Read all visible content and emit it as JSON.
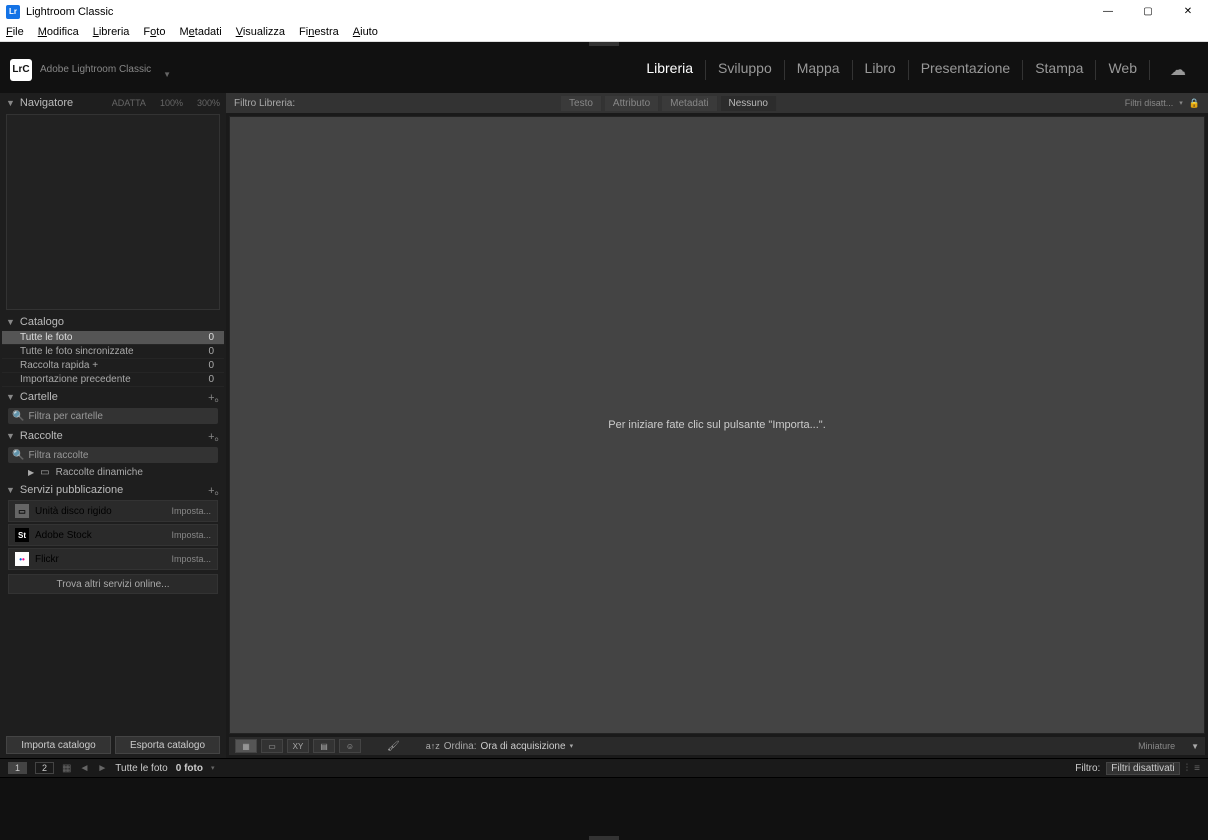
{
  "app": {
    "title": "Lightroom Classic",
    "brand": "Adobe Lightroom Classic",
    "badge": "LrC"
  },
  "menu": [
    "File",
    "Modifica",
    "Libreria",
    "Foto",
    "Metadati",
    "Visualizza",
    "Finestra",
    "Aiuto"
  ],
  "menuAccel": [
    "F",
    "M",
    "L",
    "o",
    "e",
    "V",
    "n",
    "A"
  ],
  "modules": {
    "items": [
      "Libreria",
      "Sviluppo",
      "Mappa",
      "Libro",
      "Presentazione",
      "Stampa",
      "Web"
    ],
    "active": 0
  },
  "navigator": {
    "title": "Navigatore",
    "fit": "ADATTA",
    "z100": "100%",
    "z300": "300%"
  },
  "catalog": {
    "title": "Catalogo",
    "items": [
      {
        "label": "Tutte le foto",
        "count": "0",
        "selected": true
      },
      {
        "label": "Tutte le foto sincronizzate",
        "count": "0"
      },
      {
        "label": "Raccolta rapida +",
        "count": "0"
      },
      {
        "label": "Importazione precedente",
        "count": "0"
      }
    ]
  },
  "folders": {
    "title": "Cartelle",
    "filter": "Filtra per cartelle"
  },
  "collections": {
    "title": "Raccolte",
    "filter": "Filtra raccolte",
    "smart": "Raccolte dinamiche"
  },
  "publish": {
    "title": "Servizi pubblicazione",
    "services": [
      {
        "badge": "",
        "label": "Unità disco rigido",
        "action": "Imposta..."
      },
      {
        "badge": "St",
        "label": "Adobe Stock",
        "action": "Imposta..."
      },
      {
        "badge": "••",
        "label": "Flickr",
        "action": "Imposta..."
      }
    ],
    "find": "Trova altri servizi online..."
  },
  "buttons": {
    "import": "Importa catalogo",
    "export": "Esporta catalogo"
  },
  "filterbar": {
    "label": "Filtro Libreria:",
    "tabs": [
      "Testo",
      "Attributo",
      "Metadati",
      "Nessuno"
    ],
    "activeTab": 3,
    "disabled": "Filtri disatt..."
  },
  "viewport": {
    "hint": "Per iniziare fate clic sul pulsante \"Importa...\"."
  },
  "toolbar": {
    "sort": "Ordina:",
    "sortby": "Ora di acquisizione",
    "thumbs": "Miniature"
  },
  "status": {
    "label": "Tutte le foto",
    "count": "0 foto",
    "filter": "Filtro:",
    "value": "Filtri disattivati"
  }
}
